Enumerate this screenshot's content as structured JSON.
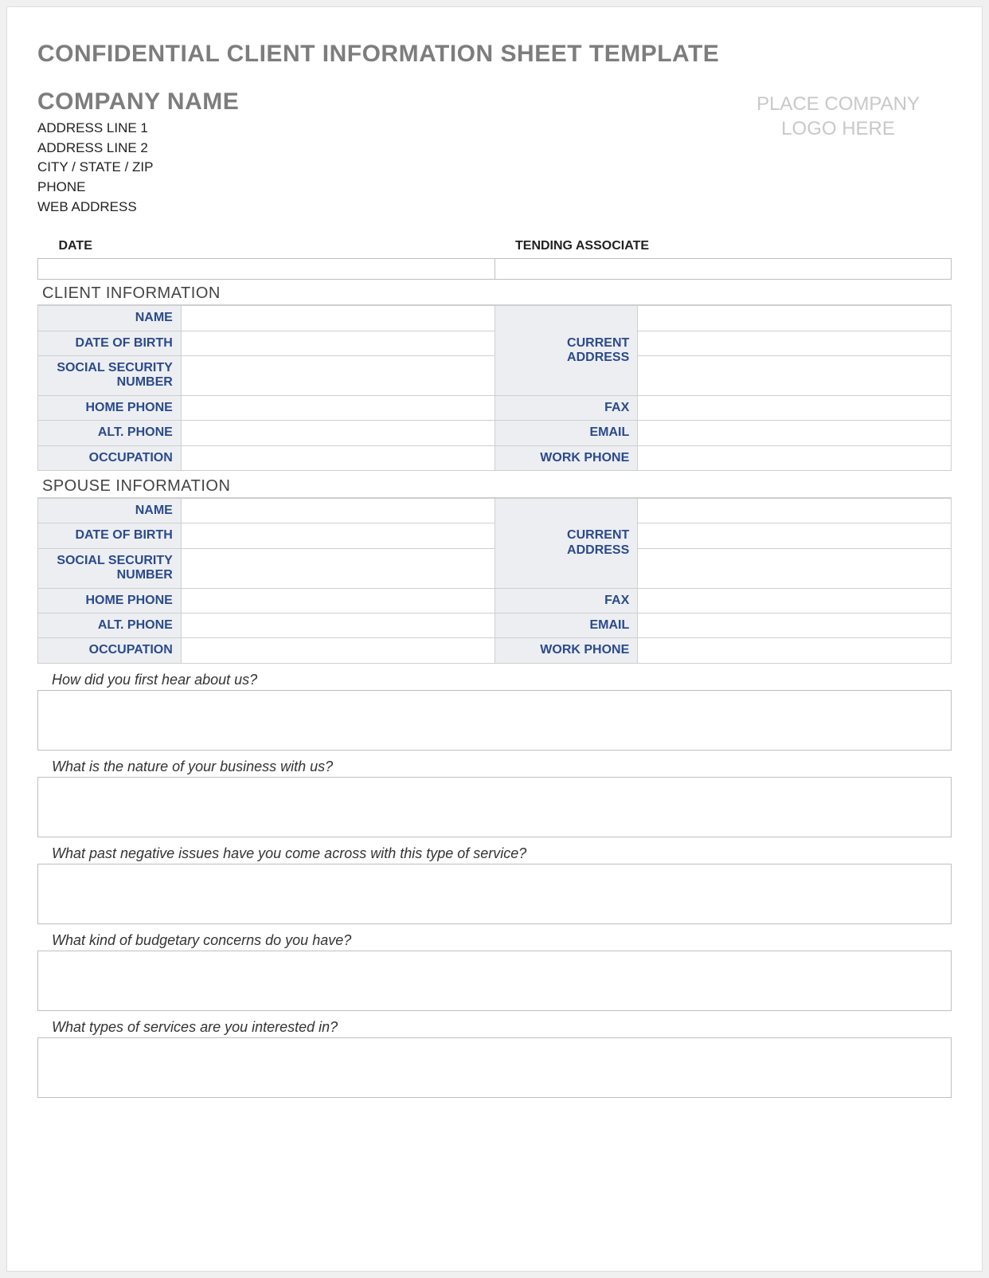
{
  "title": "CONFIDENTIAL CLIENT INFORMATION SHEET TEMPLATE",
  "company": {
    "name": "COMPANY NAME",
    "address1": "ADDRESS LINE 1",
    "address2": "ADDRESS LINE 2",
    "city_state_zip": "CITY / STATE / ZIP",
    "phone": "PHONE",
    "web": "WEB ADDRESS"
  },
  "logo_placeholder_line1": "PLACE COMPANY",
  "logo_placeholder_line2": "LOGO HERE",
  "top_fields": {
    "date_label": "DATE",
    "associate_label": "TENDING ASSOCIATE"
  },
  "client_section_title": "CLIENT INFORMATION",
  "spouse_section_title": "SPOUSE INFORMATION",
  "labels": {
    "name": "NAME",
    "dob": "DATE OF BIRTH",
    "ssn": "SOCIAL SECURITY NUMBER",
    "home_phone": "HOME PHONE",
    "alt_phone": "ALT. PHONE",
    "occupation": "OCCUPATION",
    "current_address": "CURRENT ADDRESS",
    "fax": "FAX",
    "email": "EMAIL",
    "work_phone": "WORK PHONE"
  },
  "questions": {
    "q1": "How did you first hear about us?",
    "q2": "What is the nature of your business with us?",
    "q3": "What past negative issues have you come across with this type of service?",
    "q4": "What kind of budgetary concerns do you have?",
    "q5": "What types of services are you interested in?"
  }
}
